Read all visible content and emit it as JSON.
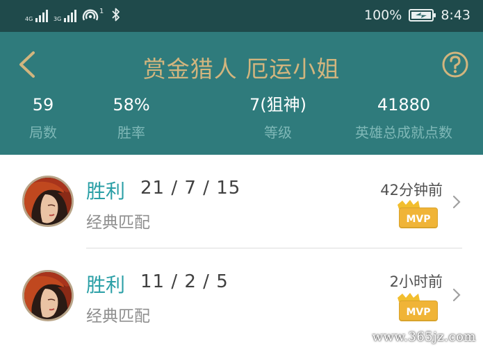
{
  "status_bar": {
    "net1_label": "4G",
    "net2_label": "3G",
    "hotspot_count": "1",
    "battery": "100%",
    "battery_level": 1.0,
    "time": "8:43"
  },
  "header": {
    "title": "赏金猎人 厄运小姐",
    "stats": [
      {
        "value": "59",
        "label": "局数"
      },
      {
        "value": "58%",
        "label": "胜率"
      },
      {
        "value": "7(狙神)",
        "label": "等级"
      },
      {
        "value": "41880",
        "label": "英雄总成就点数"
      }
    ]
  },
  "matches": [
    {
      "result": "胜利",
      "kda": "21 / 7 / 15",
      "mode": "经典匹配",
      "time": "42分钟前",
      "badge": "MVP"
    },
    {
      "result": "胜利",
      "kda": "11 / 2 / 5",
      "mode": "经典匹配",
      "time": "2小时前",
      "badge": "MVP"
    }
  ],
  "watermark": "www.365jz.com",
  "colors": {
    "status_bg": "#1f4a4b",
    "header_bg": "#2f7b7c",
    "title_gold": "#d2b57e",
    "win_teal": "#2a9fa6",
    "mvp_gold": "#f2be2e"
  }
}
